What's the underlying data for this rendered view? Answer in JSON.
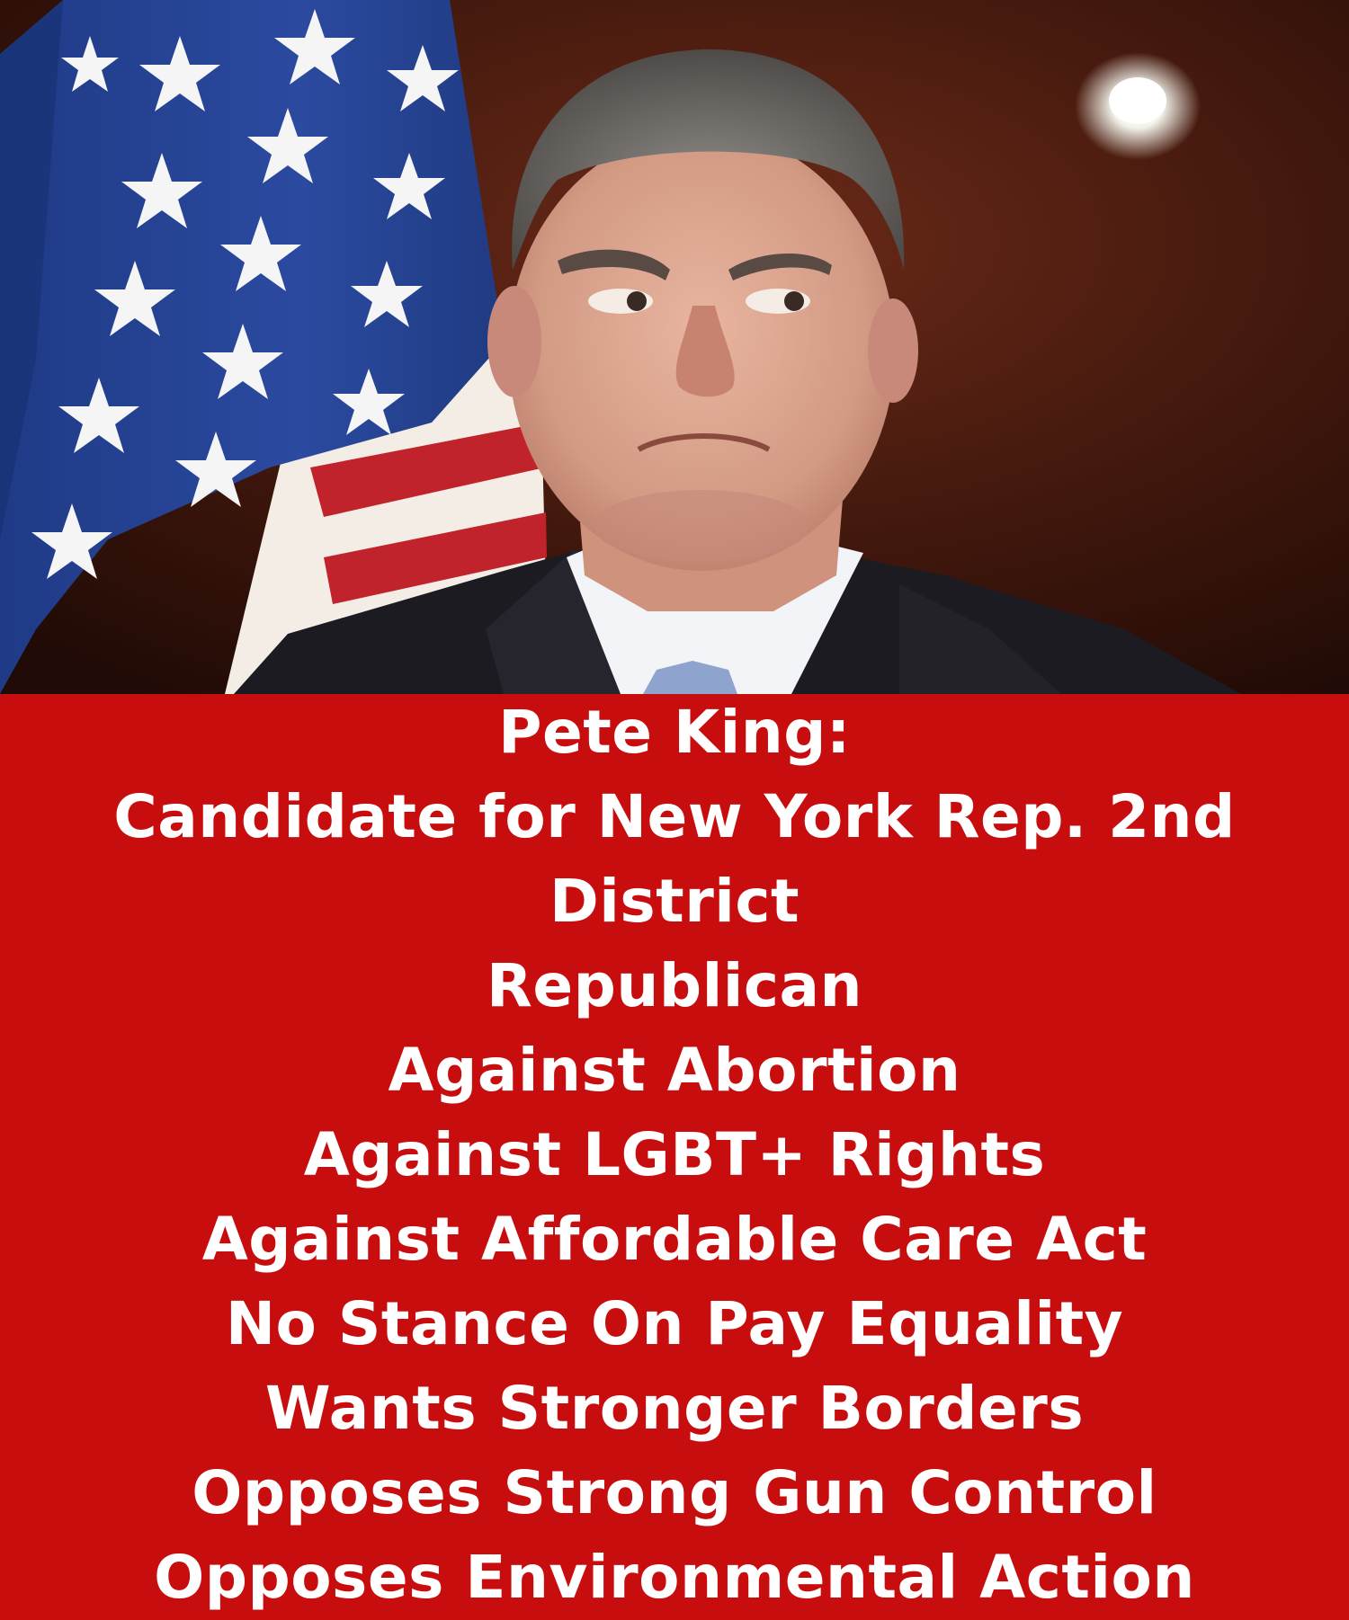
{
  "photo": {
    "subject": "man in dark suit in front of American flag",
    "icons": [
      "american-flag-icon",
      "portrait-figure-icon",
      "ceiling-light-icon"
    ]
  },
  "profile": {
    "name_line": "Pete King:",
    "candidacy_line_1": "Candidate for New York Rep. 2nd",
    "candidacy_line_2": "District",
    "party": "Republican",
    "positions": [
      "Against Abortion",
      "Against LGBT+ Rights",
      "Against Affordable Care Act",
      "No Stance On Pay Equality",
      "Wants Stronger Borders",
      "Opposes Strong Gun Control",
      "Opposes Environmental Action"
    ]
  },
  "colors": {
    "panel_background": "#c80d0e",
    "text": "#ffffff"
  }
}
